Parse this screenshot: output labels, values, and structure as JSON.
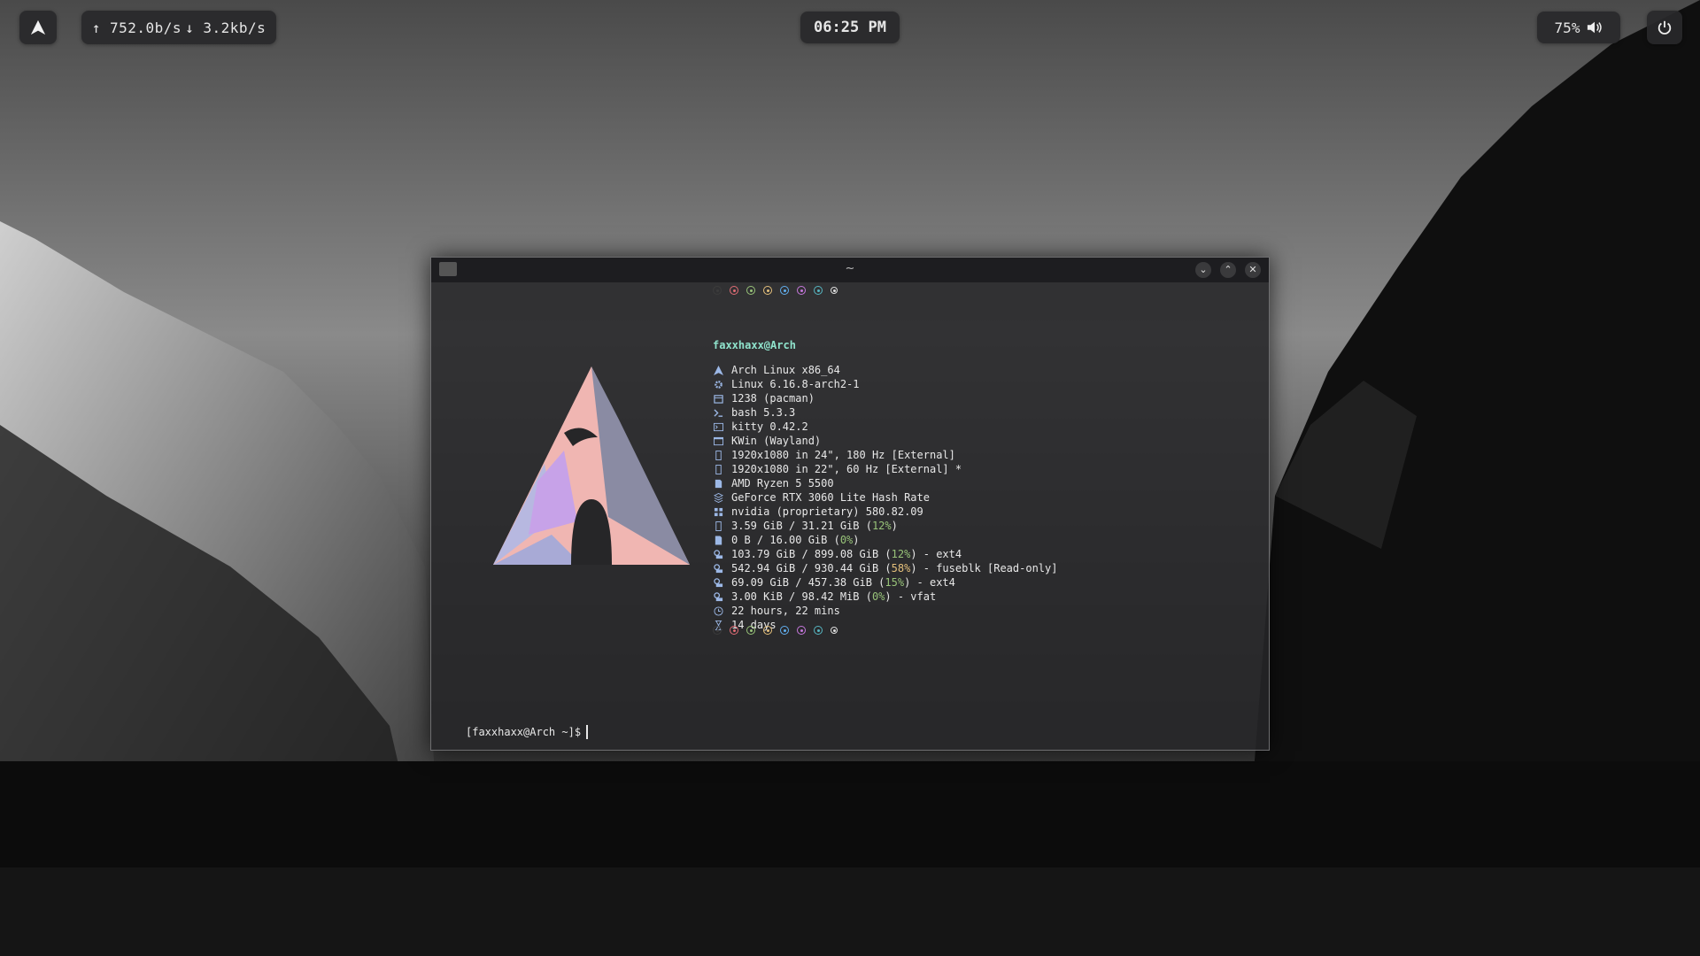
{
  "topbar": {
    "net_up": "↑ 752.0b/s",
    "net_down": "↓ 3.2kb/s",
    "clock": "06:25 PM",
    "volume": "75%"
  },
  "window": {
    "title": "~"
  },
  "fetch": {
    "userhost": "faxxhaxx@Arch",
    "rows": [
      {
        "icon": "arch-icon",
        "text": "Arch Linux x86_64"
      },
      {
        "icon": "gear-icon",
        "text": "Linux 6.16.8-arch2-1"
      },
      {
        "icon": "package-icon",
        "text": "1238 (pacman)"
      },
      {
        "icon": "shell-icon",
        "text": "bash 5.3.3"
      },
      {
        "icon": "terminal-icon",
        "text": "kitty 0.42.2"
      },
      {
        "icon": "window-icon",
        "text": "KWin (Wayland)"
      },
      {
        "icon": "display-icon",
        "text": "1920x1080 in 24\", 180 Hz [External]"
      },
      {
        "icon": "display-icon",
        "text": "1920x1080 in 22\", 60 Hz [External] *"
      },
      {
        "icon": "cpu-icon",
        "text": "AMD Ryzen 5 5500"
      },
      {
        "icon": "gpu-icon",
        "text": "GeForce RTX 3060 Lite Hash Rate"
      },
      {
        "icon": "driver-icon",
        "text": "nvidia (proprietary) 580.82.09"
      },
      {
        "icon": "memory-icon",
        "pre": "3.59 GiB / 31.21 GiB (",
        "pct": "12%",
        "post": ")"
      },
      {
        "icon": "swap-icon",
        "pre": "0 B / 16.00 GiB (",
        "pct": "0%",
        "post": ")"
      },
      {
        "icon": "disk-icon",
        "pre": "103.79 GiB / 899.08 GiB (",
        "pct": "12%",
        "post": ") - ext4"
      },
      {
        "icon": "disk-icon",
        "pre": "542.94 GiB / 930.44 GiB (",
        "pct": "58%",
        "post": ") - fuseblk [Read-only]",
        "pct_color": "#e5c07b"
      },
      {
        "icon": "disk-icon",
        "pre": "69.09 GiB / 457.38 GiB (",
        "pct": "15%",
        "post": ") - ext4"
      },
      {
        "icon": "disk-icon",
        "pre": "3.00 KiB / 98.42 MiB (",
        "pct": "0%",
        "post": ") - vfat"
      },
      {
        "icon": "clock-icon",
        "text": "22 hours, 22 mins"
      },
      {
        "icon": "hourglass-icon",
        "text": "14 days"
      }
    ],
    "pct_color": "#98c379",
    "dot_colors": [
      "#3c3c3c",
      "#e06c75",
      "#98c379",
      "#e5c07b",
      "#61afef",
      "#c678dd",
      "#56b6c2",
      "#dcdcdc"
    ]
  },
  "prompt": "[faxxhaxx@Arch ~]$"
}
